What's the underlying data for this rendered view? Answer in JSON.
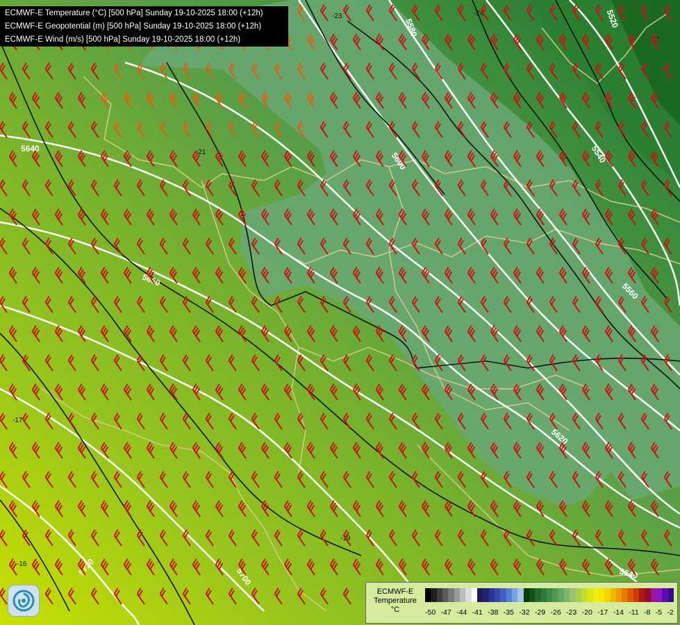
{
  "titles": {
    "line1": "ECMWF-E Temperature (°C) [500 hPa] Sunday 19-10-2025 18:00 (+12h)",
    "line2": "ECMWF-E Geopotential (m) [500 hPa] Sunday 19-10-2025 18:00 (+12h)",
    "line3": "ECMWF-E Wind (m/s) [500 hPa] Sunday 19-10-2025 18:00 (+12h)"
  },
  "legend": {
    "label_line1": "ECMWF-E",
    "label_line2": "Temperature",
    "label_line3": "°C",
    "ticks": [
      "-50",
      "-47",
      "-44",
      "-41",
      "-38",
      "-35",
      "-32",
      "-29",
      "-26",
      "-23",
      "-20",
      "-17",
      "-14",
      "-11",
      "-8",
      "-5",
      "-2"
    ],
    "colors": [
      "#000000",
      "#1e1e1e",
      "#3c3c3c",
      "#5a5a5a",
      "#7a7a7a",
      "#9a9a9a",
      "#bcbcbc",
      "#dedede",
      "#ffffff",
      "#1a1a5c",
      "#22247a",
      "#2a3596",
      "#3448ae",
      "#4162c2",
      "#5880d2",
      "#7aa2e0",
      "#a6c6ee",
      "#0a3d0a",
      "#15521a",
      "#236a2a",
      "#2f7a36",
      "#3d8a44",
      "#4e9a52",
      "#62a85e",
      "#7ab66a",
      "#94c276",
      "#a8d04a",
      "#c2dc2a",
      "#dce614",
      "#f0ee10",
      "#f6e800",
      "#f6d400",
      "#f2b800",
      "#ee9a00",
      "#e87a00",
      "#de5a00",
      "#cc3a0a",
      "#b41818",
      "#9a0a2a",
      "#a0149a",
      "#8a18c8",
      "#5a10b0",
      "#3a0a8a"
    ]
  },
  "contour_labels": {
    "geopotential": [
      "5580",
      "5520",
      "5640",
      "5600",
      "5540",
      "5660",
      "5560",
      "5620",
      "5720",
      "5700",
      "5640"
    ],
    "temperature": [
      "-23",
      "-24",
      "-27",
      "-21",
      "-19",
      "-17",
      "-16"
    ]
  },
  "colors": {
    "cold_dark": "#1f7a24",
    "cold_mid": "#3e8f40",
    "cold_air_mass": "#5a9e62",
    "mid_green": "#78b82a",
    "warm_lime": "#9cc81a",
    "warm_yellow": "#c9e000",
    "barb_red": "#c81414",
    "barb_orange": "#e06010",
    "border": "#e0cc90"
  },
  "icons": {
    "logo": "ecmwf-swirl-icon"
  }
}
